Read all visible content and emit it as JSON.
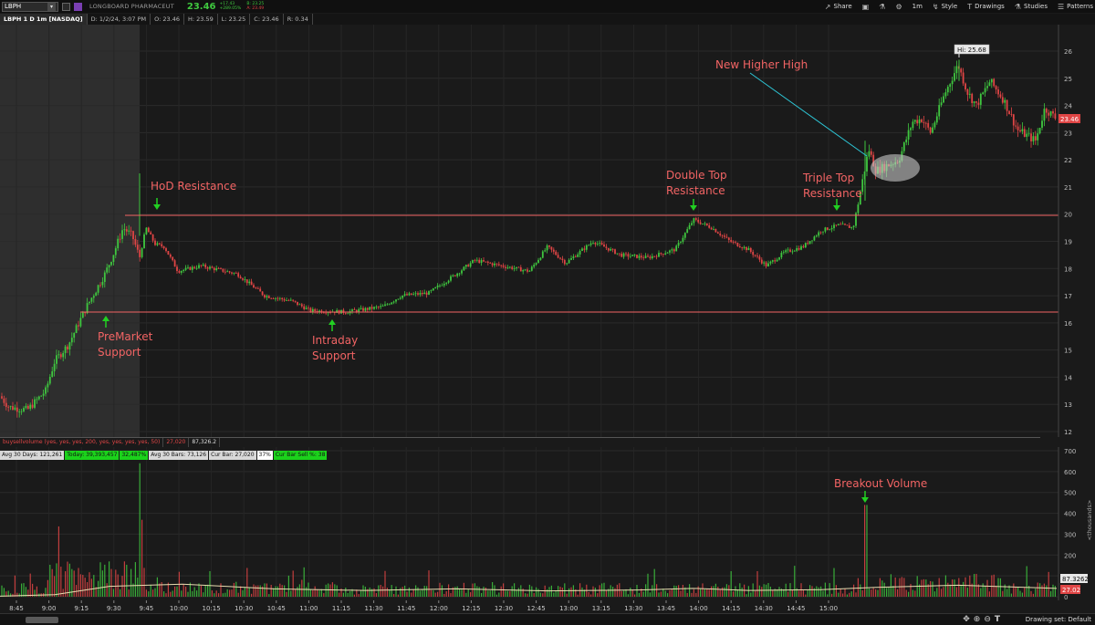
{
  "toolbar": {
    "symbol": "LBPH",
    "company": "LONGBOARD PHARMACEUT",
    "last": "23.46",
    "change": "+17.43",
    "change_pct": "+289.05%",
    "bid": "B: 23.25",
    "ask": "A: 23.49",
    "share": "Share",
    "timeframe": "1m",
    "style": "Style",
    "drawings": "Drawings",
    "studies": "Studies",
    "patterns": "Patterns"
  },
  "infobar": {
    "title": "LBPH 1 D 1m [NASDAQ]",
    "date": "D: 1/2/24, 3:07 PM",
    "open": "O: 23.46",
    "high": "H: 23.59",
    "low": "L: 23.25",
    "close": "C: 23.46",
    "range": "R: 0.34"
  },
  "price_axis": {
    "ticks": [
      "26",
      "25",
      "24",
      "23",
      "22",
      "21",
      "20",
      "19",
      "18",
      "17",
      "16",
      "15",
      "14",
      "13",
      "12"
    ],
    "last_label": "23.46",
    "hi_label": "Hi: 25.68"
  },
  "annotations": {
    "new_high": "New Higher High",
    "hod_resistance": "HoD Resistance",
    "double_top_1": "Double Top",
    "double_top_2": "Resistance",
    "triple_top_1": "Triple Top",
    "triple_top_2": "Resistance",
    "premarket_1": "PreMarket",
    "premarket_2": "Support",
    "intraday_1": "Intraday",
    "intraday_2": "Support",
    "breakout_volume": "Breakout Volume"
  },
  "volume": {
    "study_name": "buysellvolume (yes, yes, yes, 200, yes, yes, yes, yes, 50)",
    "val1": "27,020",
    "val2": "87,326.2",
    "stats": {
      "avg30days": "Avg 30 Days: 121,261",
      "today": "Today: 39,393,457",
      "today_pct": "32,487%",
      "avg30bars": "Avg 30 Bars: 73,126",
      "cur_bar": "Cur Bar: 27,020",
      "pct": "37%",
      "sell_pct": "Cur Bar Sell %: 38"
    },
    "axis_ticks": [
      "700",
      "600",
      "500",
      "400",
      "300",
      "200",
      "100",
      "0"
    ],
    "axis_unit": "<thousands>",
    "avg_label": "87.3262",
    "cur_label": "27.02"
  },
  "time_axis": [
    "8:45",
    "9:00",
    "9:15",
    "9:30",
    "9:45",
    "10:00",
    "10:15",
    "10:30",
    "10:45",
    "11:00",
    "11:15",
    "11:30",
    "11:45",
    "12:00",
    "12:15",
    "12:30",
    "12:45",
    "13:00",
    "13:15",
    "13:30",
    "13:45",
    "14:00",
    "14:15",
    "14:30",
    "14:45",
    "15:00"
  ],
  "bottom": {
    "drawing_set": "Drawing set: Default"
  },
  "colors": {
    "up": "#3fc73f",
    "down": "#e04545",
    "line": "#f26464",
    "annotation": "#f26464",
    "arrow": "#22d022",
    "trendline": "#2dc6d6"
  }
}
